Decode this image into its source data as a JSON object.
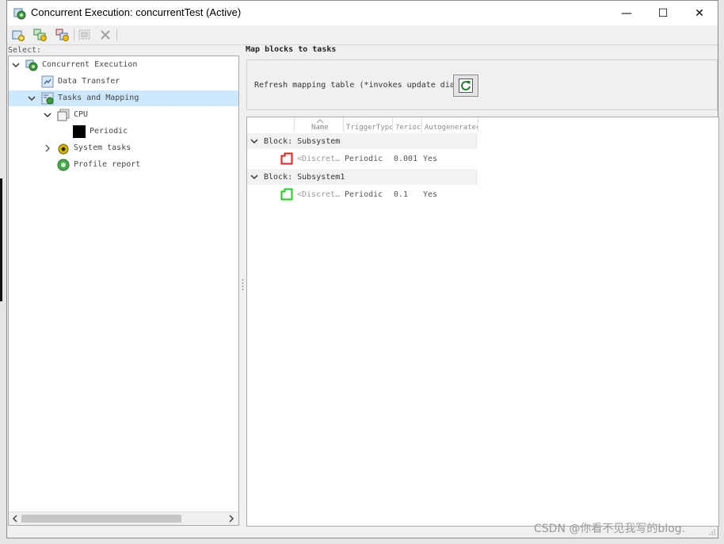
{
  "window": {
    "title": "Concurrent Execution: concurrentTest (Active)",
    "controls": {
      "minimize": "—",
      "maximize": "☐",
      "close": "✕"
    }
  },
  "toolbar": {
    "buttons": [
      {
        "name": "add-task-button",
        "icon": "add-node-icon"
      },
      {
        "name": "add-subtask-button",
        "icon": "add-child-icon"
      },
      {
        "name": "add-trigger-button",
        "icon": "add-trigger-icon"
      },
      {
        "name": "edit-button",
        "icon": "edit-icon"
      },
      {
        "name": "delete-button",
        "icon": "delete-x-icon"
      }
    ]
  },
  "tree": {
    "select_label": "Select:",
    "items": [
      {
        "label": "Concurrent Execution",
        "icon": "concurrent-gear-icon",
        "expanded": true
      },
      {
        "label": "Data Transfer",
        "icon": "data-transfer-icon"
      },
      {
        "label": "Tasks and Mapping",
        "icon": "tasks-mapping-icon",
        "expanded": true,
        "selected": true
      },
      {
        "label": "CPU",
        "icon": "cpu-icon",
        "expanded": true
      },
      {
        "label": "Periodic",
        "icon": "black-square-icon"
      },
      {
        "label": "System tasks",
        "icon": "system-tasks-icon",
        "expanded": false
      },
      {
        "label": "Profile report",
        "icon": "profile-report-icon"
      }
    ]
  },
  "panel": {
    "title": "Map blocks to tasks",
    "refresh_label": "Refresh mapping table (*invokes update diagram)",
    "refresh_icon": "refresh-arrow-icon"
  },
  "table": {
    "columns": [
      "Name",
      "TriggerTypc",
      "?erioc",
      "Autogeneratec"
    ],
    "groups": [
      {
        "label": "Block: Subsystem",
        "rows": [
          {
            "name": "<Discret…",
            "trigger": "Periodic",
            "period": "0.001",
            "auto": "Yes",
            "color": "#e02020"
          }
        ]
      },
      {
        "label": "Block: Subsystem1",
        "rows": [
          {
            "name": "<Discret…",
            "trigger": "Periodic",
            "period": "0.1",
            "auto": "Yes",
            "color": "#22cc22"
          }
        ]
      }
    ]
  },
  "watermark": "CSDN @你看不见我写的blog."
}
